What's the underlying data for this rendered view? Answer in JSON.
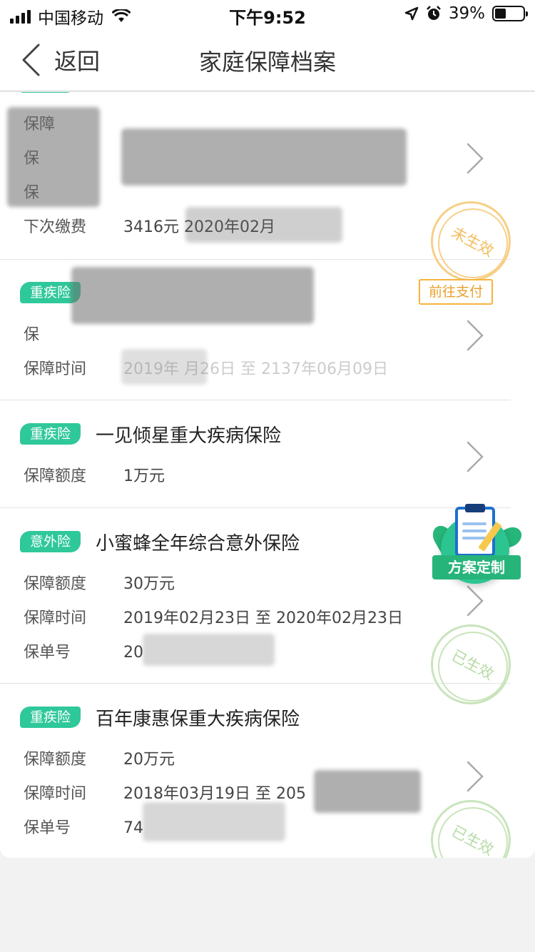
{
  "status_bar": {
    "carrier": "中国移动",
    "time": "下午9:52",
    "battery": "39%",
    "battery_level": 0.39
  },
  "nav": {
    "back_label": "返回",
    "title": "家庭保障档案"
  },
  "policies": [
    {
      "tag": "",
      "title": "",
      "rows": [
        {
          "label": "保障",
          "value": ""
        },
        {
          "label": "保",
          "value": ""
        },
        {
          "label": "保",
          "value": ""
        },
        {
          "label": "下次缴费",
          "value": "3416元  2020年02月"
        }
      ],
      "stamp": "未生效"
    },
    {
      "tag": "重疾险",
      "title": "",
      "action": "前往支付",
      "rows": [
        {
          "label": "保",
          "value": ""
        },
        {
          "label": "保障时间",
          "value": "2019年  月26日 至 2137年06月09日"
        }
      ]
    },
    {
      "tag": "重疾险",
      "title": "一见倾星重大疾病保险",
      "rows": [
        {
          "label": "保障额度",
          "value": "1万元"
        }
      ]
    },
    {
      "tag": "意外险",
      "title": "小蜜蜂全年综合意外保险",
      "rows": [
        {
          "label": "保障额度",
          "value": "30万元"
        },
        {
          "label": "保障时间",
          "value": "2019年02月23日 至 2020年02月23日"
        },
        {
          "label": "保单号",
          "value": "20"
        }
      ],
      "stamp": "已生效"
    },
    {
      "tag": "重疾险",
      "title": "百年康惠保重大疾病保险",
      "rows": [
        {
          "label": "保障额度",
          "value": "20万元"
        },
        {
          "label": "保障时间",
          "value": "2018年03月19日 至 205"
        },
        {
          "label": "保单号",
          "value": "74"
        }
      ],
      "stamp": "已生效"
    }
  ],
  "fab": {
    "label": "方案定制"
  },
  "colors": {
    "accent_green": "#2fc89a",
    "pending_orange": "#f5b43b",
    "active_stamp": "#c9e4bb"
  }
}
